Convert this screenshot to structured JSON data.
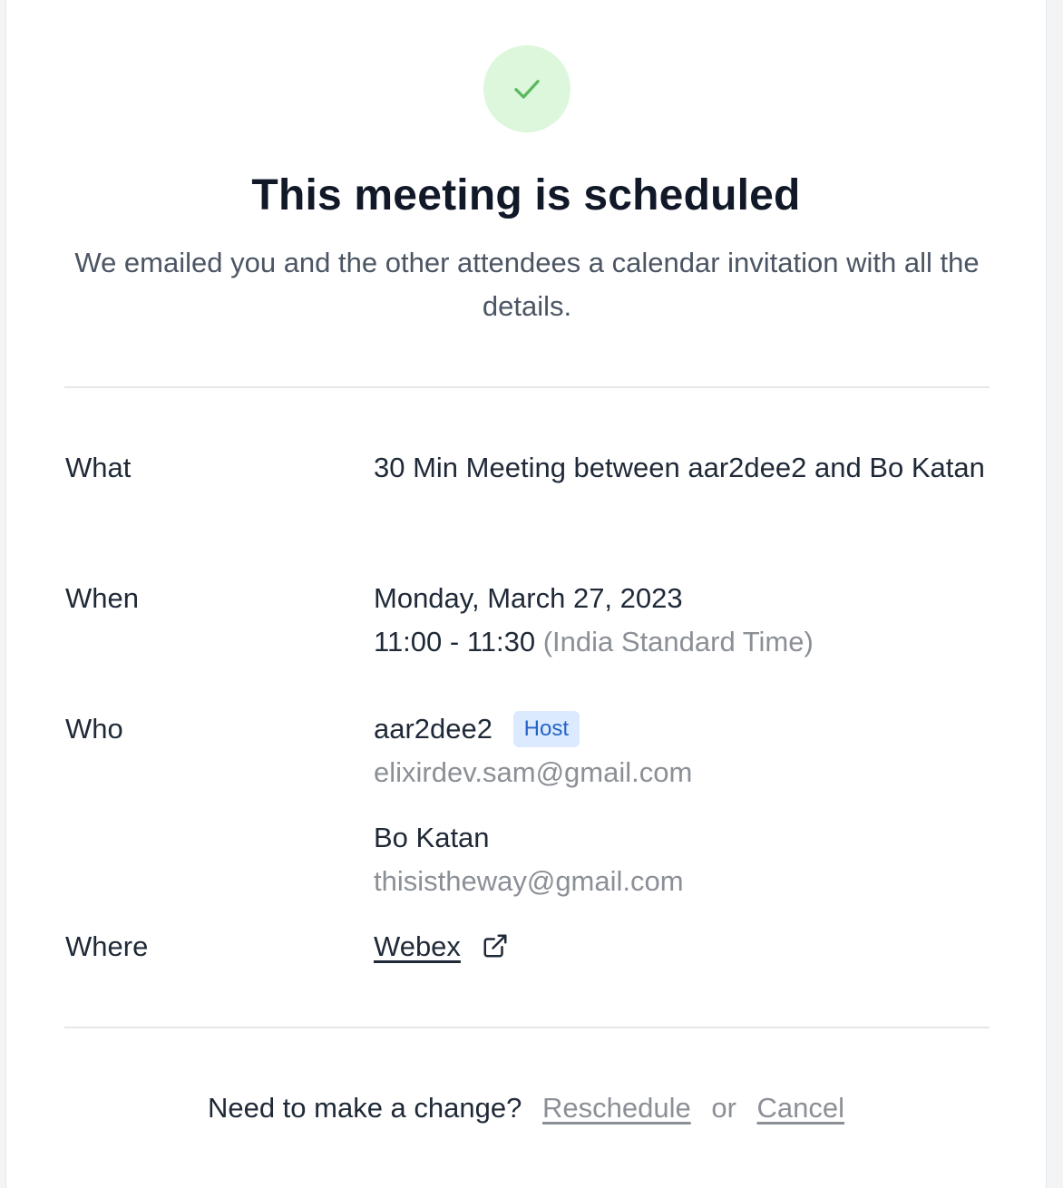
{
  "header": {
    "title": "This meeting is scheduled",
    "subtitle": "We emailed you and the other attendees a calendar invitation with all the details.",
    "status_icon": "check-icon",
    "success_color": "#5cb85c"
  },
  "details": {
    "what": {
      "label": "What",
      "value": "30 Min Meeting between aar2dee2 and Bo Katan"
    },
    "when": {
      "label": "When",
      "date": "Monday, March 27, 2023",
      "time": "11:00 - 11:30",
      "timezone": "(India Standard Time)"
    },
    "who": {
      "label": "Who",
      "attendees": [
        {
          "name": "aar2dee2",
          "badge": "Host",
          "email": "elixirdev.sam@gmail.com"
        },
        {
          "name": "Bo Katan",
          "email": "thisistheway@gmail.com"
        }
      ]
    },
    "where": {
      "label": "Where",
      "location": "Webex",
      "icon": "external-link-icon"
    }
  },
  "footer": {
    "prompt": "Need to make a change?",
    "reschedule": "Reschedule",
    "or": "or",
    "cancel": "Cancel"
  }
}
